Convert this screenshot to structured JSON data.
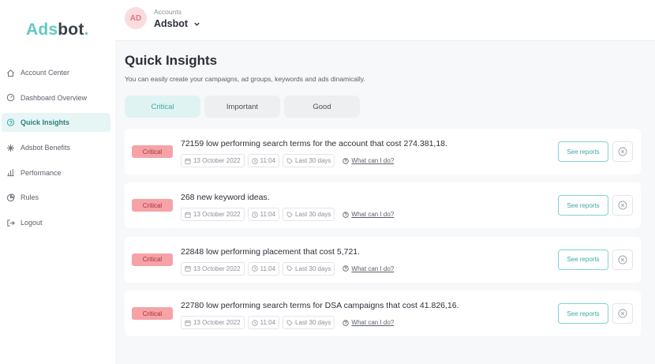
{
  "brand": {
    "logo_part1": "Ads",
    "logo_part2": "bot",
    "logo_dot": "."
  },
  "sidebar": {
    "items": [
      {
        "label": "Account Center",
        "icon": "home-icon"
      },
      {
        "label": "Dashboard Overview",
        "icon": "gauge-icon"
      },
      {
        "label": "Quick Insights",
        "icon": "lightbulb-icon",
        "active": true
      },
      {
        "label": "Adsbot Benefits",
        "icon": "sparkle-icon"
      },
      {
        "label": "Performance",
        "icon": "bar-chart-icon"
      },
      {
        "label": "Rules",
        "icon": "pie-icon"
      },
      {
        "label": "Logout",
        "icon": "logout-icon"
      }
    ]
  },
  "header": {
    "avatar_initials": "AD",
    "accounts_label": "Accounts",
    "account_name": "Adsbot"
  },
  "main": {
    "title": "Quick Insights",
    "subtitle": "You can easily create your campaigns, ad groups, keywords and ads dinamically.",
    "tabs": [
      {
        "label": "Critical",
        "active": true
      },
      {
        "label": "Important"
      },
      {
        "label": "Good"
      }
    ],
    "insights": [
      {
        "badge": "Critical",
        "title": "72159 low performing search terms for the account that cost 274.381,18.",
        "date": "13 October 2022",
        "time": "11:04",
        "range": "Last 30 days",
        "help": "What can I do?",
        "action": "See reports"
      },
      {
        "badge": "Critical",
        "title": "268 new keyword ideas.",
        "date": "13 October 2022",
        "time": "11:04",
        "range": "Last 30 days",
        "help": "What can I do?",
        "action": "See reports"
      },
      {
        "badge": "Critical",
        "title": "22848 low performing placement that cost 5,721.",
        "date": "13 October 2022",
        "time": "11:04",
        "range": "Last 30 days",
        "help": "What can I do?",
        "action": "See reports"
      },
      {
        "badge": "Critical",
        "title": "22780 low performing search terms for DSA campaigns that cost 41.826,16.",
        "date": "13 October 2022",
        "time": "11:04",
        "range": "Last 30 days",
        "help": "What can I do?",
        "action": "See reports"
      }
    ]
  },
  "colors": {
    "accent": "#62c9c5",
    "critical_bg": "#f6a3a8",
    "avatar_bg": "#fadcdf"
  }
}
